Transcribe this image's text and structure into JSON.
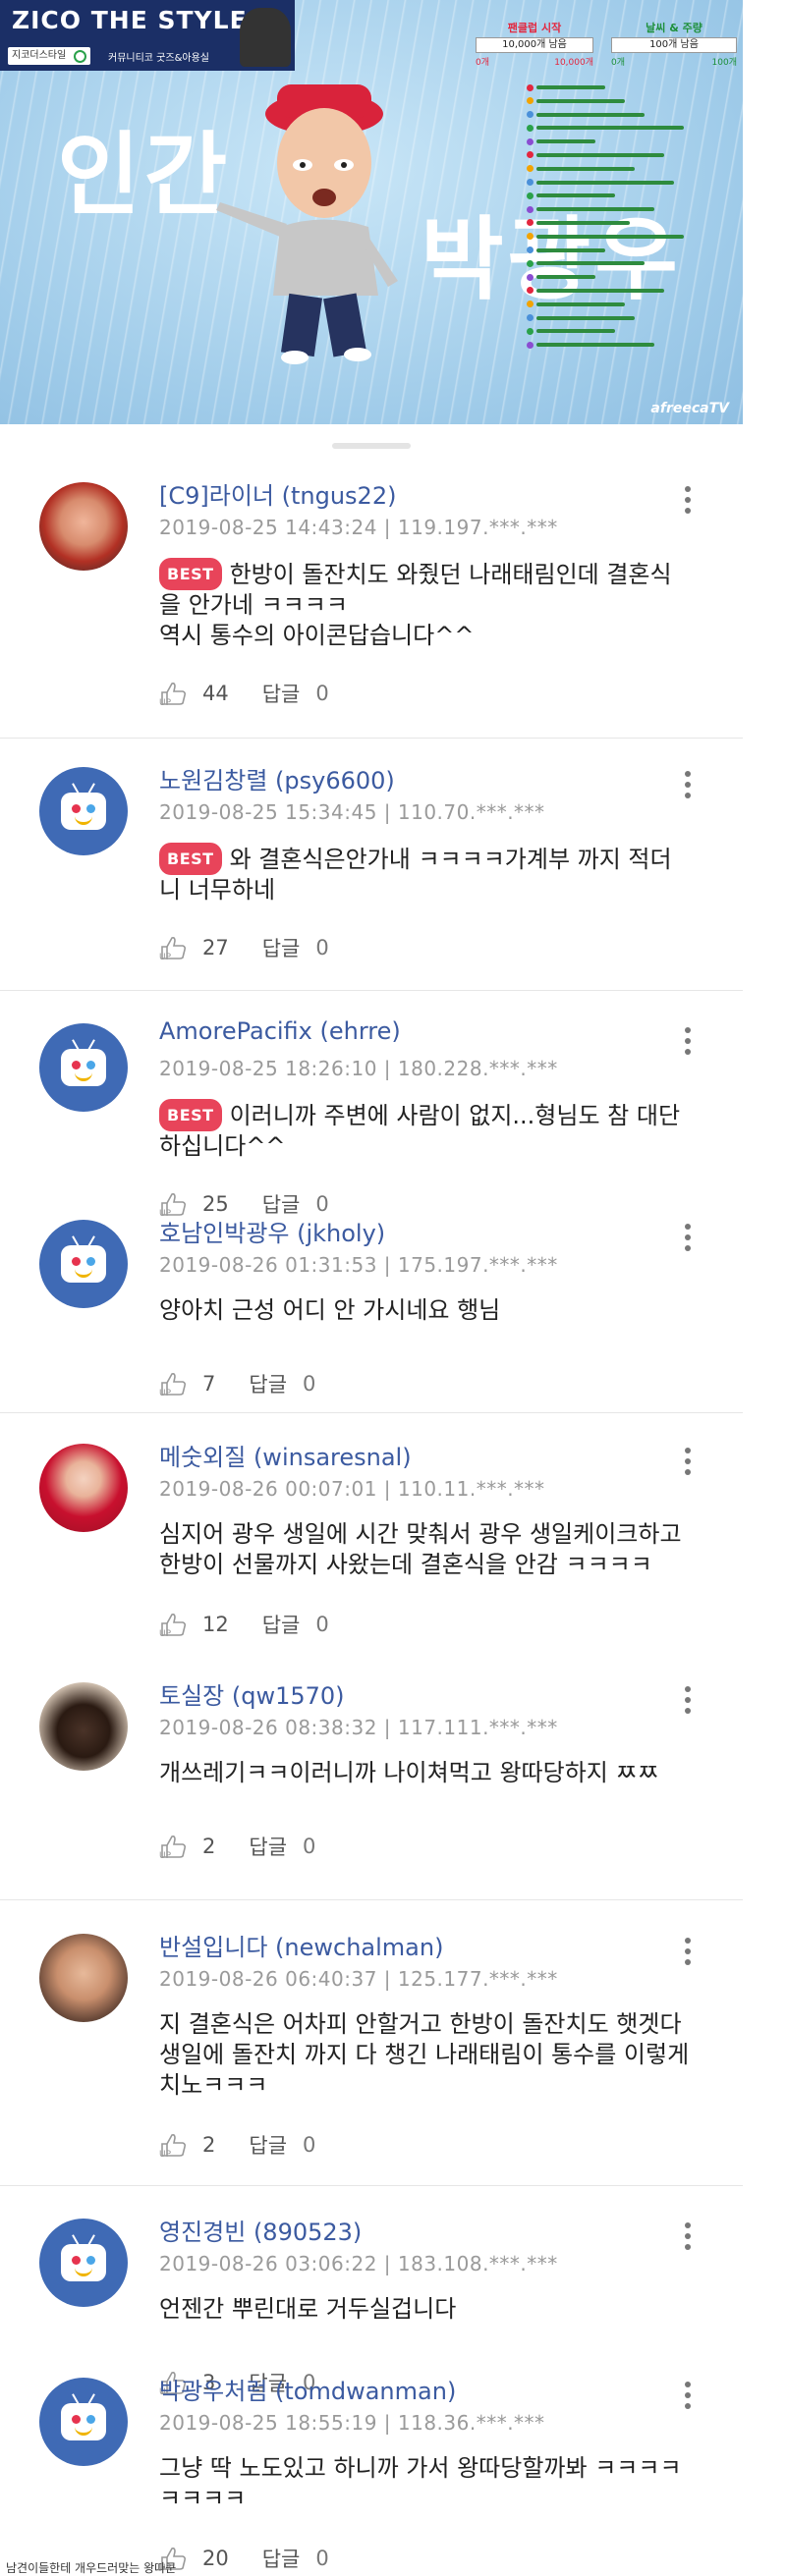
{
  "banner": {
    "logo_title": "ZICO THE STYLE",
    "logo_search": "지코더스타일",
    "logo_sub": "커뮤니티코 굿즈&아용실",
    "big_text_1": "인간",
    "big_text_2": "박광우",
    "stat_a_head": "팬클럽 시작",
    "stat_a_value": "10,000개 남음",
    "stat_a_left": "0개",
    "stat_a_right": "10,000개",
    "stat_b_head": "날씨 & 주량",
    "stat_b_value": "100개 남음",
    "stat_b_left": "0개",
    "stat_b_right": "100개",
    "watermark": "afreecaTV"
  },
  "comments": [
    {
      "author": "[C9]라이너 (tngus22)",
      "meta": "2019-08-25 14:43:24  | 119.197.***.***",
      "best": true,
      "text_lines": [
        "한방이 돌잔치도 와줬던 나래태림인데 결혼식",
        "을 안가네 ㅋㅋㅋㅋ",
        "역시 통수의 아이콘답습니다^^"
      ],
      "up": "44",
      "reply_label": "답글",
      "replies": "0"
    },
    {
      "author": "노원김창렬 (psy6600)",
      "meta": "2019-08-25 15:34:45  | 110.70.***.***",
      "best": true,
      "text_lines": [
        "와 결혼식은안가내 ㅋㅋㅋㅋ가계부 까지 적더",
        "니 너무하네"
      ],
      "up": "27",
      "reply_label": "답글",
      "replies": "0"
    },
    {
      "author": "AmorePacifix (ehrre)",
      "meta": "2019-08-25 18:26:10  | 180.228.***.***",
      "best": true,
      "text_lines": [
        "이러니까 주변에 사람이 없지...형님도 참 대단",
        "하십니다^^"
      ],
      "up": "25",
      "reply_label": "답글",
      "replies": "0"
    },
    {
      "author": "호남인박광우 (jkholy)",
      "meta": "2019-08-26 01:31:53  | 175.197.***.***",
      "best": false,
      "text_lines": [
        "양아치 근성 어디 안 가시네요 행님"
      ],
      "up": "7",
      "reply_label": "답글",
      "replies": "0"
    },
    {
      "author": "메숫외질 (winsaresnal)",
      "meta": "2019-08-26 00:07:01  | 110.11.***.***",
      "best": false,
      "text_lines": [
        "심지어 광우 생일에 시간 맞춰서 광우 생일케이크하고",
        "한방이 선물까지 사왔는데 결혼식을 안감 ㅋㅋㅋㅋ"
      ],
      "up": "12",
      "reply_label": "답글",
      "replies": "0"
    },
    {
      "author": "토실장 (qw1570)",
      "meta": "2019-08-26 08:38:32  | 117.111.***.***",
      "best": false,
      "text_lines": [
        "개쓰레기ㅋㅋ이러니까 나이쳐먹고 왕따당하지 ㅉㅉ"
      ],
      "up": "2",
      "reply_label": "답글",
      "replies": "0"
    },
    {
      "author": "반설입니다 (newchalman)",
      "meta": "2019-08-26 06:40:37  | 125.177.***.***",
      "best": false,
      "text_lines": [
        "지 결혼식은 어차피 안할거고 한방이 돌잔치도 햇겟다",
        "생일에 돌잔치 까지 다 챙긴 나래태림이 통수를 이렇게",
        "치노ㅋㅋㅋ"
      ],
      "up": "2",
      "reply_label": "답글",
      "replies": "0"
    },
    {
      "author": "영진경빈 (890523)",
      "meta": "2019-08-26 03:06:22  | 183.108.***.***",
      "best": false,
      "text_lines": [
        "언젠간 뿌린대로 거두실겁니다"
      ],
      "up": "3",
      "reply_label": "답글",
      "replies": "0"
    },
    {
      "author": "박광우처럼 (tomdwanman)",
      "meta": "2019-08-25 18:55:19  | 118.36.***.***",
      "best": false,
      "text_lines": [
        "그냥 딱 노도있고 하니까 가서 왕따당할까봐 ㅋㅋㅋㅋ",
        "ㅋㅋㅋㅋ"
      ],
      "up": "20",
      "reply_label": "답글",
      "replies": "0"
    }
  ],
  "best_label": "BEST",
  "up_label": "UP",
  "bottom_caption": "남견이들한테    개우드러맞는 왕따쿤",
  "colors": {
    "author": "#3b5aa0",
    "best_badge": "#e8445a",
    "meta": "#9a9a9a",
    "banner_bg": "#a9d3ee",
    "logo_bg": "#1b2f66",
    "default_avatar": "#3f6ab5"
  }
}
